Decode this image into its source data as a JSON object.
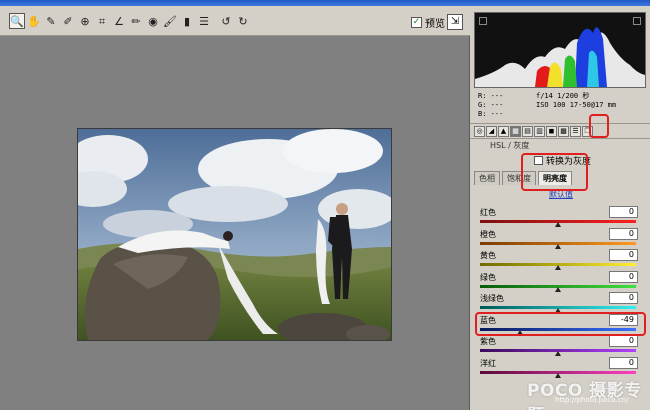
{
  "toolbar": {
    "tools": [
      {
        "name": "zoom-tool",
        "icon": "magnifier-icon",
        "glyph": "🔍",
        "active": true
      },
      {
        "name": "hand-tool",
        "icon": "hand-icon",
        "glyph": "✋"
      },
      {
        "name": "white-balance-tool",
        "icon": "eyedropper-icon",
        "glyph": "✎"
      },
      {
        "name": "color-sampler-tool",
        "icon": "eyedropper-plus-icon",
        "glyph": "✐"
      },
      {
        "name": "target-adjust-tool",
        "icon": "target-icon",
        "glyph": "⊕"
      },
      {
        "name": "crop-tool",
        "icon": "crop-icon",
        "glyph": "⌗"
      },
      {
        "name": "straighten-tool",
        "icon": "angle-icon",
        "glyph": "∠"
      },
      {
        "name": "spot-removal-tool",
        "icon": "brush-icon",
        "glyph": "✏"
      },
      {
        "name": "red-eye-tool",
        "icon": "eye-icon",
        "glyph": "◉"
      },
      {
        "name": "adjustment-brush-tool",
        "icon": "paintbrush-icon",
        "glyph": "🖌"
      },
      {
        "name": "graduated-filter-tool",
        "icon": "gradient-icon",
        "glyph": "▮"
      },
      {
        "name": "preferences-tool",
        "icon": "list-icon",
        "glyph": "☰"
      },
      {
        "name": "rotate-left-tool",
        "icon": "rotate-left-icon",
        "glyph": "↺"
      },
      {
        "name": "rotate-right-tool",
        "icon": "rotate-right-icon",
        "glyph": "↻"
      }
    ],
    "preview_label": "预览",
    "preview_checked": true
  },
  "readout": {
    "r": "R:  ---",
    "g": "G:  ---",
    "b": "B:  ---",
    "exposure": "f/14   1/200 秒",
    "iso_lens": "ISO 100   17-50@17 mm"
  },
  "panel": {
    "tabs": [
      "basic-icon",
      "tone-curve-icon",
      "detail-icon",
      "hsl-icon",
      "split-toning-icon",
      "lens-icon",
      "effects-icon",
      "calibration-icon",
      "presets-icon",
      "snapshots-icon"
    ],
    "selected_tab": 3,
    "section_title": "HSL / 灰度",
    "convert_label": "转换为灰度",
    "subtabs": [
      "色相",
      "饱和度",
      "明亮度"
    ],
    "selected_subtab": 2,
    "default_link": "默认值",
    "sliders": [
      {
        "label": "红色",
        "value": "0",
        "position": 0.5,
        "colors": [
          "#7a1010",
          "#ff2020"
        ]
      },
      {
        "label": "橙色",
        "value": "0",
        "position": 0.5,
        "colors": [
          "#7a3a00",
          "#ff9a20"
        ]
      },
      {
        "label": "黄色",
        "value": "0",
        "position": 0.5,
        "colors": [
          "#6e6a00",
          "#ffef30"
        ]
      },
      {
        "label": "绿色",
        "value": "0",
        "position": 0.5,
        "colors": [
          "#0a5a0a",
          "#40e040"
        ]
      },
      {
        "label": "浅绿色",
        "value": "0",
        "position": 0.5,
        "colors": [
          "#005a5a",
          "#30f0f0"
        ]
      },
      {
        "label": "蓝色",
        "value": "-49",
        "position": 0.255,
        "colors": [
          "#08185a",
          "#3a70ff"
        ]
      },
      {
        "label": "紫色",
        "value": "0",
        "position": 0.5,
        "colors": [
          "#3a0a5a",
          "#b040ff"
        ]
      },
      {
        "label": "洋红",
        "value": "0",
        "position": 0.5,
        "colors": [
          "#5a0a3a",
          "#ff40c0"
        ]
      }
    ]
  },
  "watermark": {
    "brand": "POCO 摄影专题",
    "url": "http://photo.poco.cn/"
  },
  "colors": {
    "highlight": "#e02020",
    "canvas": "#808080",
    "panel": "#d4d0c8"
  }
}
